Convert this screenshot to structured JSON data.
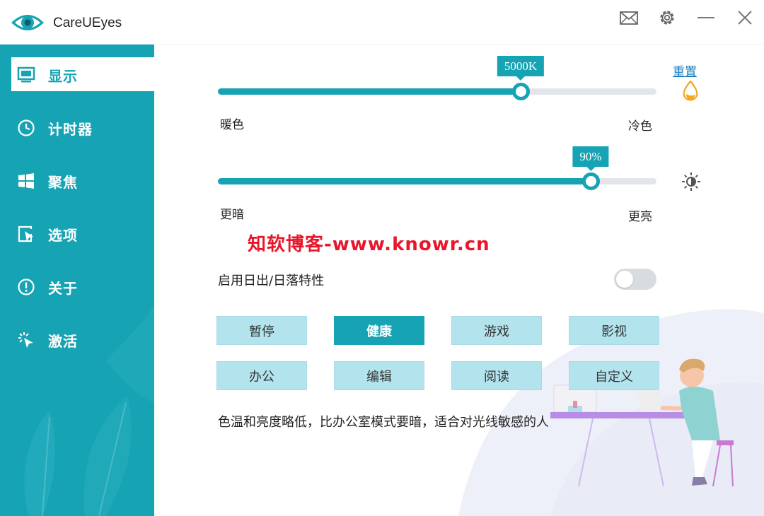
{
  "app": {
    "title": "CareUEyes"
  },
  "titlebar": {
    "buttons": [
      {
        "name": "mail-icon"
      },
      {
        "name": "gear-icon"
      },
      {
        "name": "minimize-icon"
      },
      {
        "name": "close-icon"
      }
    ]
  },
  "sidebar": {
    "items": [
      {
        "label": "显示",
        "icon": "monitor-icon",
        "active": true
      },
      {
        "label": "计时器",
        "icon": "clock-icon",
        "active": false
      },
      {
        "label": "聚焦",
        "icon": "windows-icon",
        "active": false
      },
      {
        "label": "选项",
        "icon": "options-icon",
        "active": false
      },
      {
        "label": "关于",
        "icon": "info-icon",
        "active": false
      },
      {
        "label": "激活",
        "icon": "activate-icon",
        "active": false
      }
    ]
  },
  "display": {
    "temperature": {
      "value_label": "5000K",
      "fraction": 0.69,
      "left_label": "暖色",
      "right_label": "冷色"
    },
    "reset_label": "重置",
    "brightness": {
      "value_label": "90%",
      "fraction": 0.85,
      "left_label": "更暗",
      "right_label": "更亮"
    },
    "watermark": "知软博客-www.knowr.cn",
    "sunset_label": "启用日出/日落特性",
    "sunset_enabled": false,
    "modes": [
      "暂停",
      "健康",
      "游戏",
      "影视",
      "办公",
      "编辑",
      "阅读",
      "自定义"
    ],
    "active_mode": "健康",
    "description": "色温和亮度略低，比办公室模式要暗，适合对光线敏感的人"
  },
  "colors": {
    "accent": "#16a3b3",
    "button_bg": "#b3e4ee",
    "reset_link": "#1a7fc1",
    "watermark": "#e8162a",
    "drop_icon": "#f5a623"
  }
}
